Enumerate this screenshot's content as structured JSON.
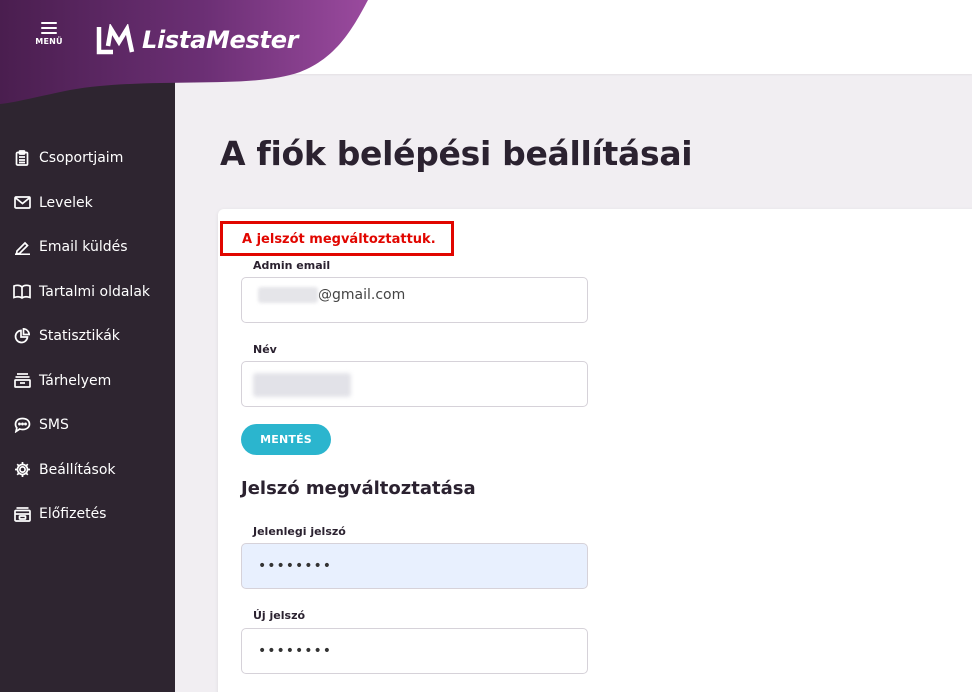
{
  "header": {
    "menu_label": "MENÜ",
    "brand": "ListaMester"
  },
  "sidebar": {
    "items": [
      {
        "label": "Csoportjaim",
        "icon": "clipboard-icon"
      },
      {
        "label": "Levelek",
        "icon": "envelope-icon"
      },
      {
        "label": "Email küldés",
        "icon": "pencil-icon"
      },
      {
        "label": "Tartalmi oldalak",
        "icon": "book-icon"
      },
      {
        "label": "Statisztikák",
        "icon": "pie-chart-icon"
      },
      {
        "label": "Tárhelyem",
        "icon": "archive-icon"
      },
      {
        "label": "SMS",
        "icon": "chat-bubble-icon"
      },
      {
        "label": "Beállítások",
        "icon": "gear-icon"
      },
      {
        "label": "Előfizetés",
        "icon": "subscription-icon"
      }
    ]
  },
  "main": {
    "title": "A fiók belépési beállításai",
    "alert": "A jelszót megváltoztattuk.",
    "admin_email_label": "Admin email",
    "admin_email_value": "@gmail.com",
    "name_label": "Név",
    "save_label": "MENTÉS",
    "password_section_title": "Jelszó megváltoztatása",
    "current_password_label": "Jelenlegi jelszó",
    "current_password_value": "••••••••",
    "new_password_label": "Új jelszó",
    "new_password_value": "••••••••"
  },
  "colors": {
    "brand_purple": "#5b2a66",
    "sidebar_bg": "#2e2530",
    "accent_button": "#2bb5ce",
    "alert_red": "#e10600"
  }
}
